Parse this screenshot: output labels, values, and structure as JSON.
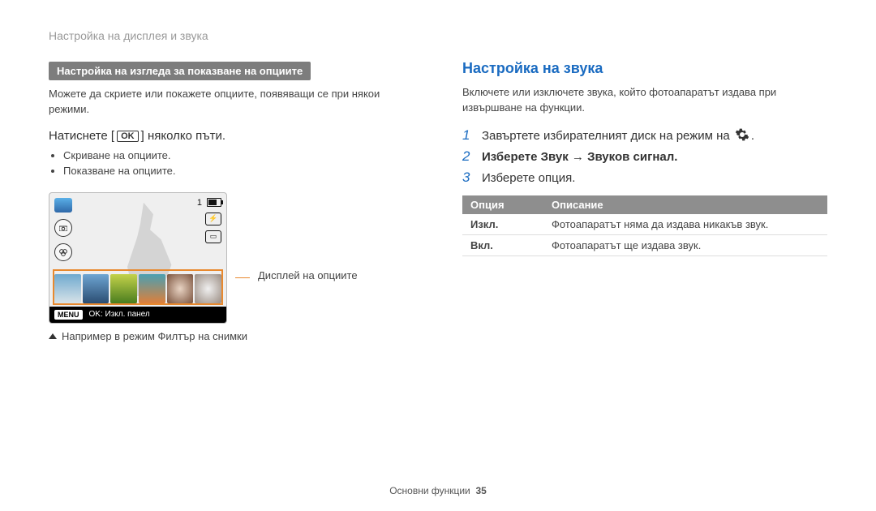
{
  "header": {
    "page_section": "Настройка на дисплея и звука"
  },
  "left": {
    "subheading_bar": "Настройка на изгледа за показване на опциите",
    "intro": "Можете да скриете или покажете опциите, появяващи се при някои режими.",
    "press_prefix": "Натиснете [",
    "ok_label": "OK",
    "press_suffix": "] няколко пъти.",
    "bullets": [
      "Скриване на опциите.",
      "Показване на опциите."
    ],
    "display": {
      "count_badge": "1",
      "menu_button": "MENU",
      "bottom_text": "OK: Изкл. панел"
    },
    "leader_label": "Дисплей на опциите",
    "caption": "Например в режим Филтър на снимки"
  },
  "right": {
    "heading": "Настройка на звука",
    "intro": "Включете или изключете звука, който фотоапаратът издава при извършване на функции.",
    "steps": [
      {
        "n": "1",
        "html": "Завъртете избирателният диск на режим на ",
        "suffix": "."
      },
      {
        "n": "2",
        "html_bold": "Изберете Звук → Звуков сигнал."
      },
      {
        "n": "3",
        "html": "Изберете опция."
      }
    ],
    "table": {
      "h1": "Опция",
      "h2": "Описание",
      "rows": [
        {
          "opt": "Изкл.",
          "desc": "Фотоапаратът няма да издава никакъв звук."
        },
        {
          "opt": "Вкл.",
          "desc": "Фотоапаратът ще издава звук."
        }
      ]
    }
  },
  "footer": {
    "text": "Основни функции",
    "page": "35"
  }
}
